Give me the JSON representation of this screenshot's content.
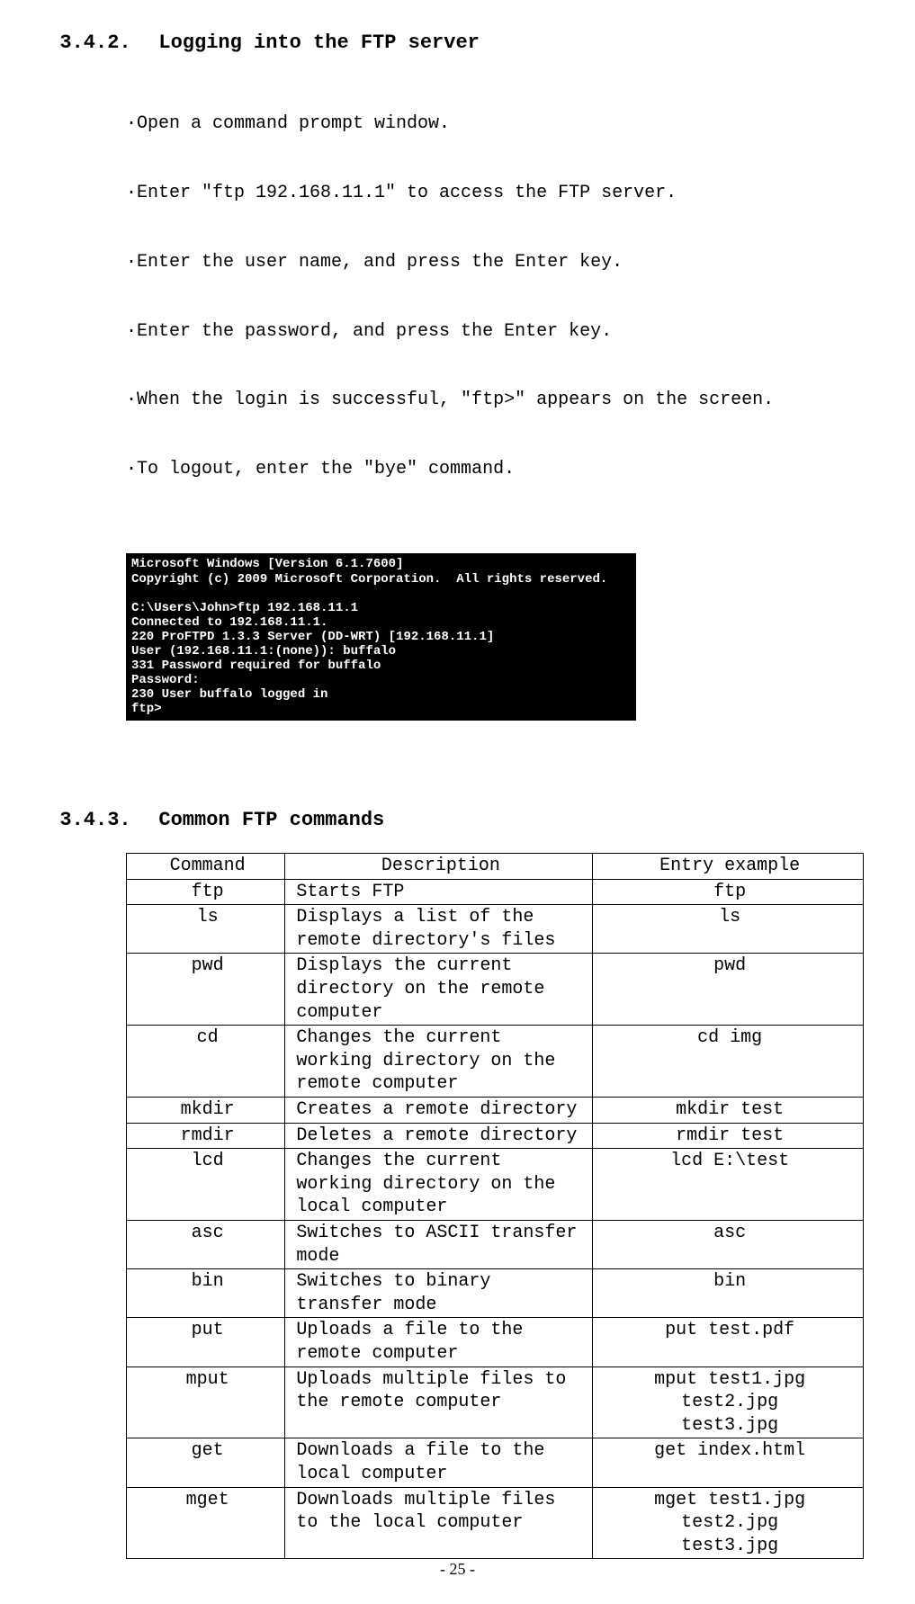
{
  "section1": {
    "num": "3.4.2.",
    "title": "Logging into the FTP server",
    "bullets": [
      "·Open a command prompt window.",
      "·Enter \"ftp 192.168.11.1\" to access the FTP server.",
      "·Enter the user name, and press the Enter key.",
      "·Enter the password, and press the Enter key.",
      "·When the login is successful, \"ftp>\" appears on the screen.",
      "·To logout, enter the \"bye\" command."
    ],
    "terminal": "Microsoft Windows [Version 6.1.7600]\nCopyright (c) 2009 Microsoft Corporation.  All rights reserved.\n\nC:\\Users\\John>ftp 192.168.11.1\nConnected to 192.168.11.1.\n220 ProFTPD 1.3.3 Server (DD-WRT) [192.168.11.1]\nUser (192.168.11.1:(none)): buffalo\n331 Password required for buffalo\nPassword:\n230 User buffalo logged in\nftp>"
  },
  "section2": {
    "num": "3.4.3.",
    "title": "Common FTP commands",
    "headers": {
      "c1": "Command",
      "c2": "Description",
      "c3": "Entry example"
    },
    "rows": [
      {
        "cmd": "ftp",
        "desc": "Starts FTP",
        "ex": "ftp"
      },
      {
        "cmd": "ls",
        "desc": "Displays a list of the remote directory's files",
        "ex": "ls"
      },
      {
        "cmd": "pwd",
        "desc": "Displays the current directory on the remote computer",
        "ex": "pwd"
      },
      {
        "cmd": "cd",
        "desc": "Changes the current working directory on the remote computer",
        "ex": "cd img"
      },
      {
        "cmd": "mkdir",
        "desc": "Creates a remote directory",
        "ex": "mkdir test"
      },
      {
        "cmd": "rmdir",
        "desc": "Deletes a remote directory",
        "ex": "rmdir test"
      },
      {
        "cmd": "lcd",
        "desc": "Changes the current working directory on the local computer",
        "ex": "lcd E:\\test"
      },
      {
        "cmd": "asc",
        "desc": "Switches to ASCII transfer mode",
        "ex": "asc"
      },
      {
        "cmd": "bin",
        "desc": "Switches to binary transfer mode",
        "ex": "bin"
      },
      {
        "cmd": "put",
        "desc": "Uploads a file to the remote computer",
        "ex": "put test.pdf"
      },
      {
        "cmd": "mput",
        "desc": "Uploads multiple files to the remote computer",
        "ex": "mput test1.jpg\ntest2.jpg\ntest3.jpg"
      },
      {
        "cmd": "get",
        "desc": "Downloads a file to the local computer",
        "ex": "get index.html"
      },
      {
        "cmd": "mget",
        "desc": "Downloads multiple files to the local computer",
        "ex": "mget test1.jpg\ntest2.jpg\ntest3.jpg"
      }
    ]
  },
  "page_number": "- 25 -"
}
